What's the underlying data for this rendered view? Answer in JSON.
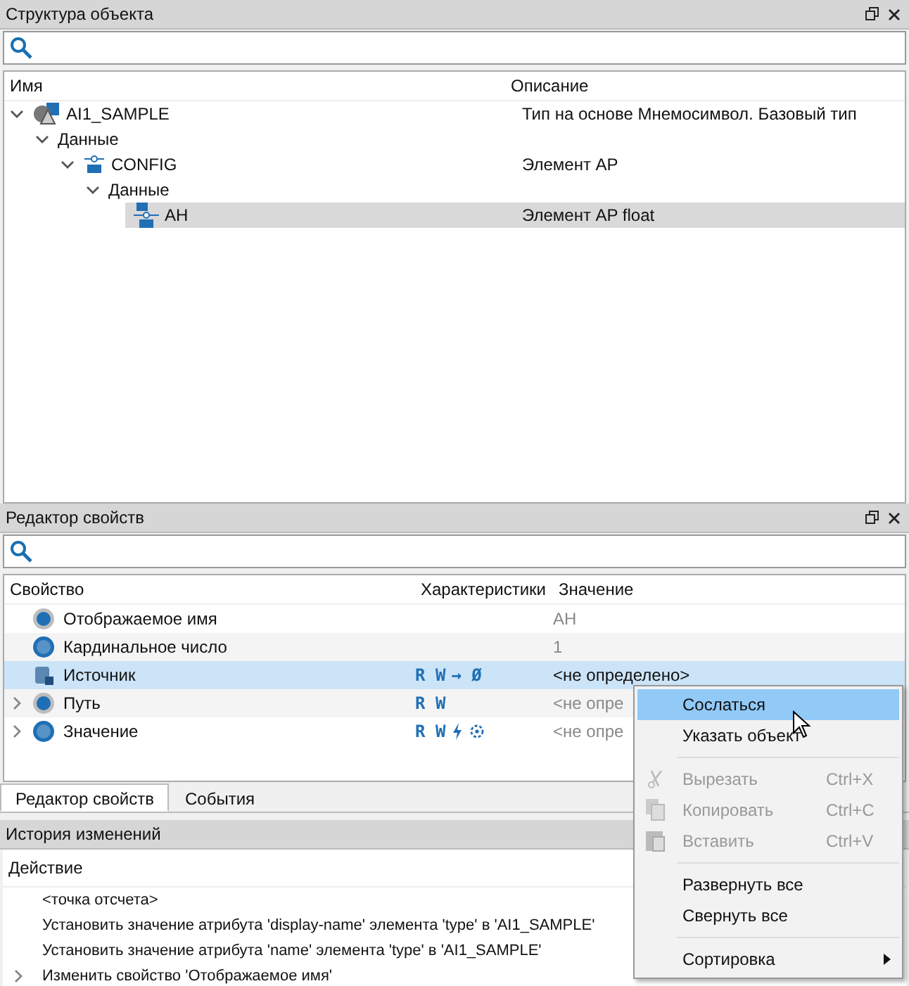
{
  "structure_panel": {
    "title": "Структура объекта",
    "columns": [
      "Имя",
      "Описание"
    ],
    "tree": [
      {
        "name": "AI1_SAMPLE",
        "description": "Тип на основе Мнемосимвол. Базовый тип",
        "kind": "type",
        "expanded": true,
        "selected": false,
        "children": [
          {
            "name": "Данные",
            "expanded": true,
            "selected": false,
            "children": [
              {
                "name": "CONFIG",
                "description": "Элемент AP",
                "kind": "ap",
                "expanded": true,
                "selected": false,
                "children": [
                  {
                    "name": "Данные",
                    "expanded": true,
                    "selected": false,
                    "children": [
                      {
                        "name": "AH",
                        "description": "Элемент AP float",
                        "kind": "apf",
                        "expanded": false,
                        "selected": true
                      }
                    ]
                  }
                ]
              }
            ]
          }
        ]
      }
    ]
  },
  "properties_panel": {
    "title": "Редактор свойств",
    "columns": [
      "Свойство",
      "Характеристики",
      "Значение"
    ],
    "rows": [
      {
        "name": "Отображаемое имя",
        "kind": "s",
        "expandable": false,
        "selected": false,
        "access": "",
        "extras": [],
        "value": "АН",
        "value_muted": true
      },
      {
        "name": "Кардинальное число",
        "kind": "i8",
        "expandable": false,
        "selected": false,
        "access": "",
        "extras": [],
        "value": "1",
        "value_muted": true
      },
      {
        "name": "Источник",
        "kind": "source",
        "expandable": false,
        "selected": true,
        "access": "R W",
        "extras": [
          {
            "kind": "text",
            "text": "→ Ø"
          }
        ],
        "value": "<не определено>",
        "value_muted": false
      },
      {
        "name": "Путь",
        "kind": "s",
        "expandable": true,
        "selected": false,
        "access": "R W",
        "extras": [],
        "value": "<не опре",
        "value_muted": true
      },
      {
        "name": "Значение",
        "kind": "f4",
        "expandable": true,
        "selected": false,
        "access": "R W",
        "extras": [
          {
            "kind": "bolt"
          },
          {
            "kind": "target"
          }
        ],
        "value": "<не опре",
        "value_muted": true
      }
    ]
  },
  "bottom_tabs": [
    {
      "label": "Редактор свойств",
      "selected": true
    },
    {
      "label": "События",
      "selected": false
    }
  ],
  "history_panel": {
    "title": "История изменений",
    "column": "Действие",
    "rows": [
      {
        "text": "<точка отсчета>",
        "expandable": false
      },
      {
        "text": "Установить значение атрибута 'display-name' элемента 'type' в 'AI1_SAMPLE'",
        "expandable": false
      },
      {
        "text": "Установить значение атрибута 'name' элемента 'type' в 'AI1_SAMPLE'",
        "expandable": false
      },
      {
        "text": "Изменить свойство 'Отображаемое имя'",
        "expandable": true
      }
    ]
  },
  "context_menu": [
    {
      "kind": "item",
      "label": "Сослаться",
      "selected": true,
      "disabled": false
    },
    {
      "kind": "item",
      "label": "Указать объект",
      "selected": false,
      "disabled": false
    },
    {
      "kind": "separator"
    },
    {
      "kind": "cut",
      "label": "Вырезать",
      "shortcut": "Ctrl+X",
      "selected": false,
      "disabled": true
    },
    {
      "kind": "copy",
      "label": "Копировать",
      "shortcut": "Ctrl+C",
      "selected": false,
      "disabled": true
    },
    {
      "kind": "paste",
      "label": "Вставить",
      "shortcut": "Ctrl+V",
      "selected": false,
      "disabled": true
    },
    {
      "kind": "separator"
    },
    {
      "kind": "item",
      "label": "Развернуть все",
      "selected": false,
      "disabled": false
    },
    {
      "kind": "item",
      "label": "Свернуть все",
      "selected": false,
      "disabled": false
    },
    {
      "kind": "separator"
    },
    {
      "kind": "submenu",
      "label": "Сортировка",
      "selected": false,
      "disabled": false
    }
  ]
}
